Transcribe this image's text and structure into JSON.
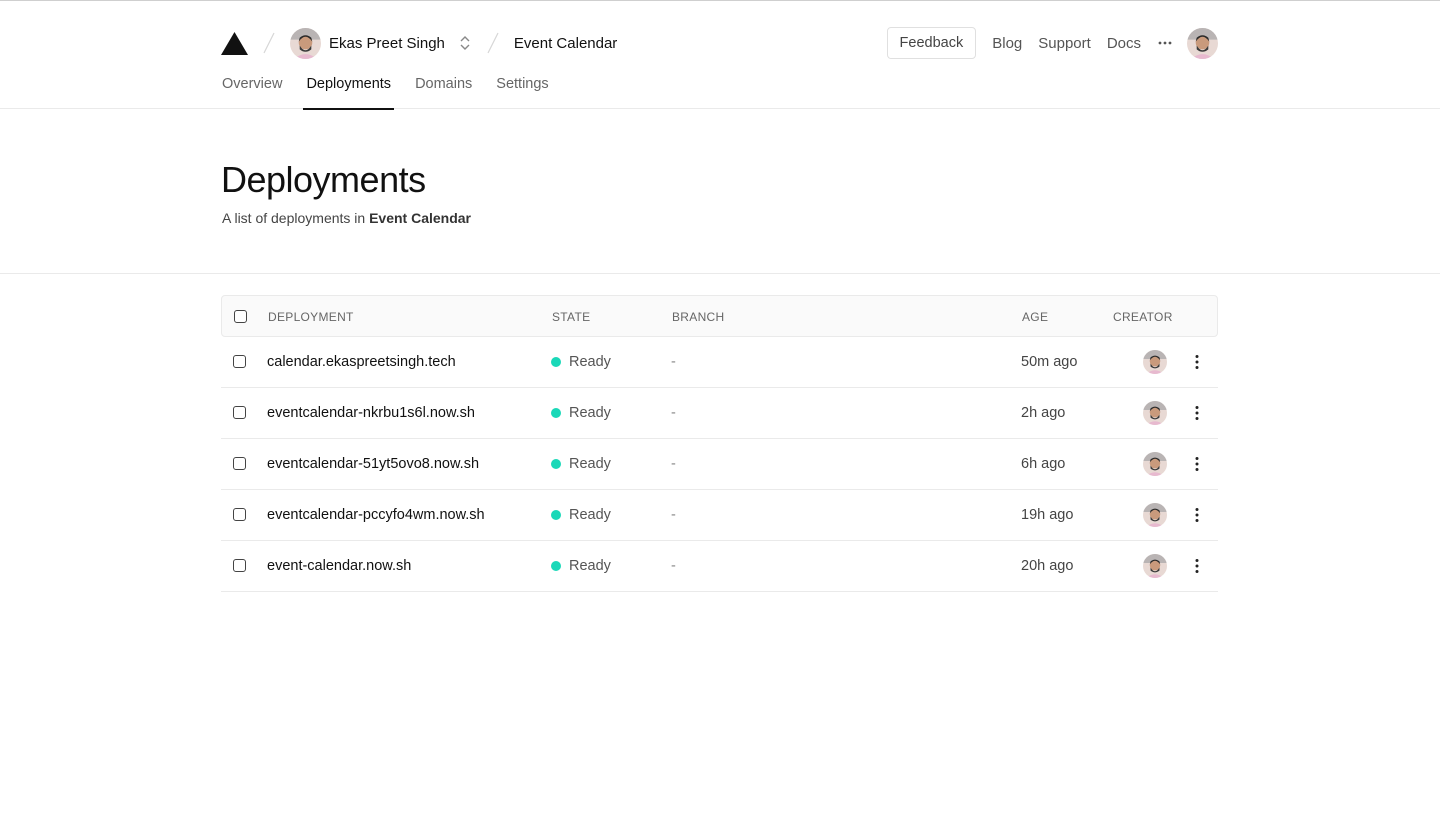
{
  "header": {
    "account_name": "Ekas Preet Singh",
    "project_name": "Event Calendar",
    "feedback_label": "Feedback",
    "nav": [
      "Blog",
      "Support",
      "Docs"
    ],
    "icons": {
      "logo": "triangle-logo-icon",
      "switcher": "chevron-up-down-icon",
      "more": "ellipsis-icon"
    }
  },
  "tabs": [
    {
      "label": "Overview",
      "active": false
    },
    {
      "label": "Deployments",
      "active": true
    },
    {
      "label": "Domains",
      "active": false
    },
    {
      "label": "Settings",
      "active": false
    }
  ],
  "page": {
    "title": "Deployments",
    "subtitle_prefix": "A list of deployments in ",
    "subtitle_project": "Event Calendar"
  },
  "table": {
    "columns": [
      "DEPLOYMENT",
      "STATE",
      "BRANCH",
      "AGE",
      "CREATOR"
    ],
    "rows": [
      {
        "deployment": "calendar.ekaspreetsingh.tech",
        "state": "Ready",
        "branch": "-",
        "age": "50m ago"
      },
      {
        "deployment": "eventcalendar-nkrbu1s6l.now.sh",
        "state": "Ready",
        "branch": "-",
        "age": "2h ago"
      },
      {
        "deployment": "eventcalendar-51yt5ovo8.now.sh",
        "state": "Ready",
        "branch": "-",
        "age": "6h ago"
      },
      {
        "deployment": "eventcalendar-pccyfo4wm.now.sh",
        "state": "Ready",
        "branch": "-",
        "age": "19h ago"
      },
      {
        "deployment": "event-calendar.now.sh",
        "state": "Ready",
        "branch": "-",
        "age": "20h ago"
      }
    ]
  },
  "colors": {
    "ready": "#1ad8b8",
    "text": "#111111",
    "border": "#eaeaea"
  }
}
